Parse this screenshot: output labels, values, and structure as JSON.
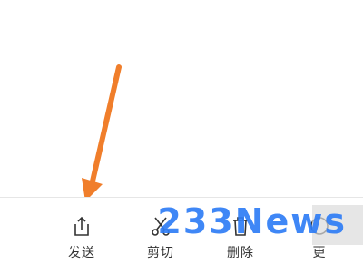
{
  "toolbar": {
    "items": [
      {
        "label": "发送",
        "icon": "share-icon"
      },
      {
        "label": "剪切",
        "icon": "scissors-icon"
      },
      {
        "label": "删除",
        "icon": "trash-icon"
      },
      {
        "label": "更",
        "icon": "more-icon"
      }
    ]
  },
  "watermark": {
    "text": "233News",
    "color": "#2f7df6"
  },
  "annotation": {
    "arrow_color": "#f07e2b"
  }
}
